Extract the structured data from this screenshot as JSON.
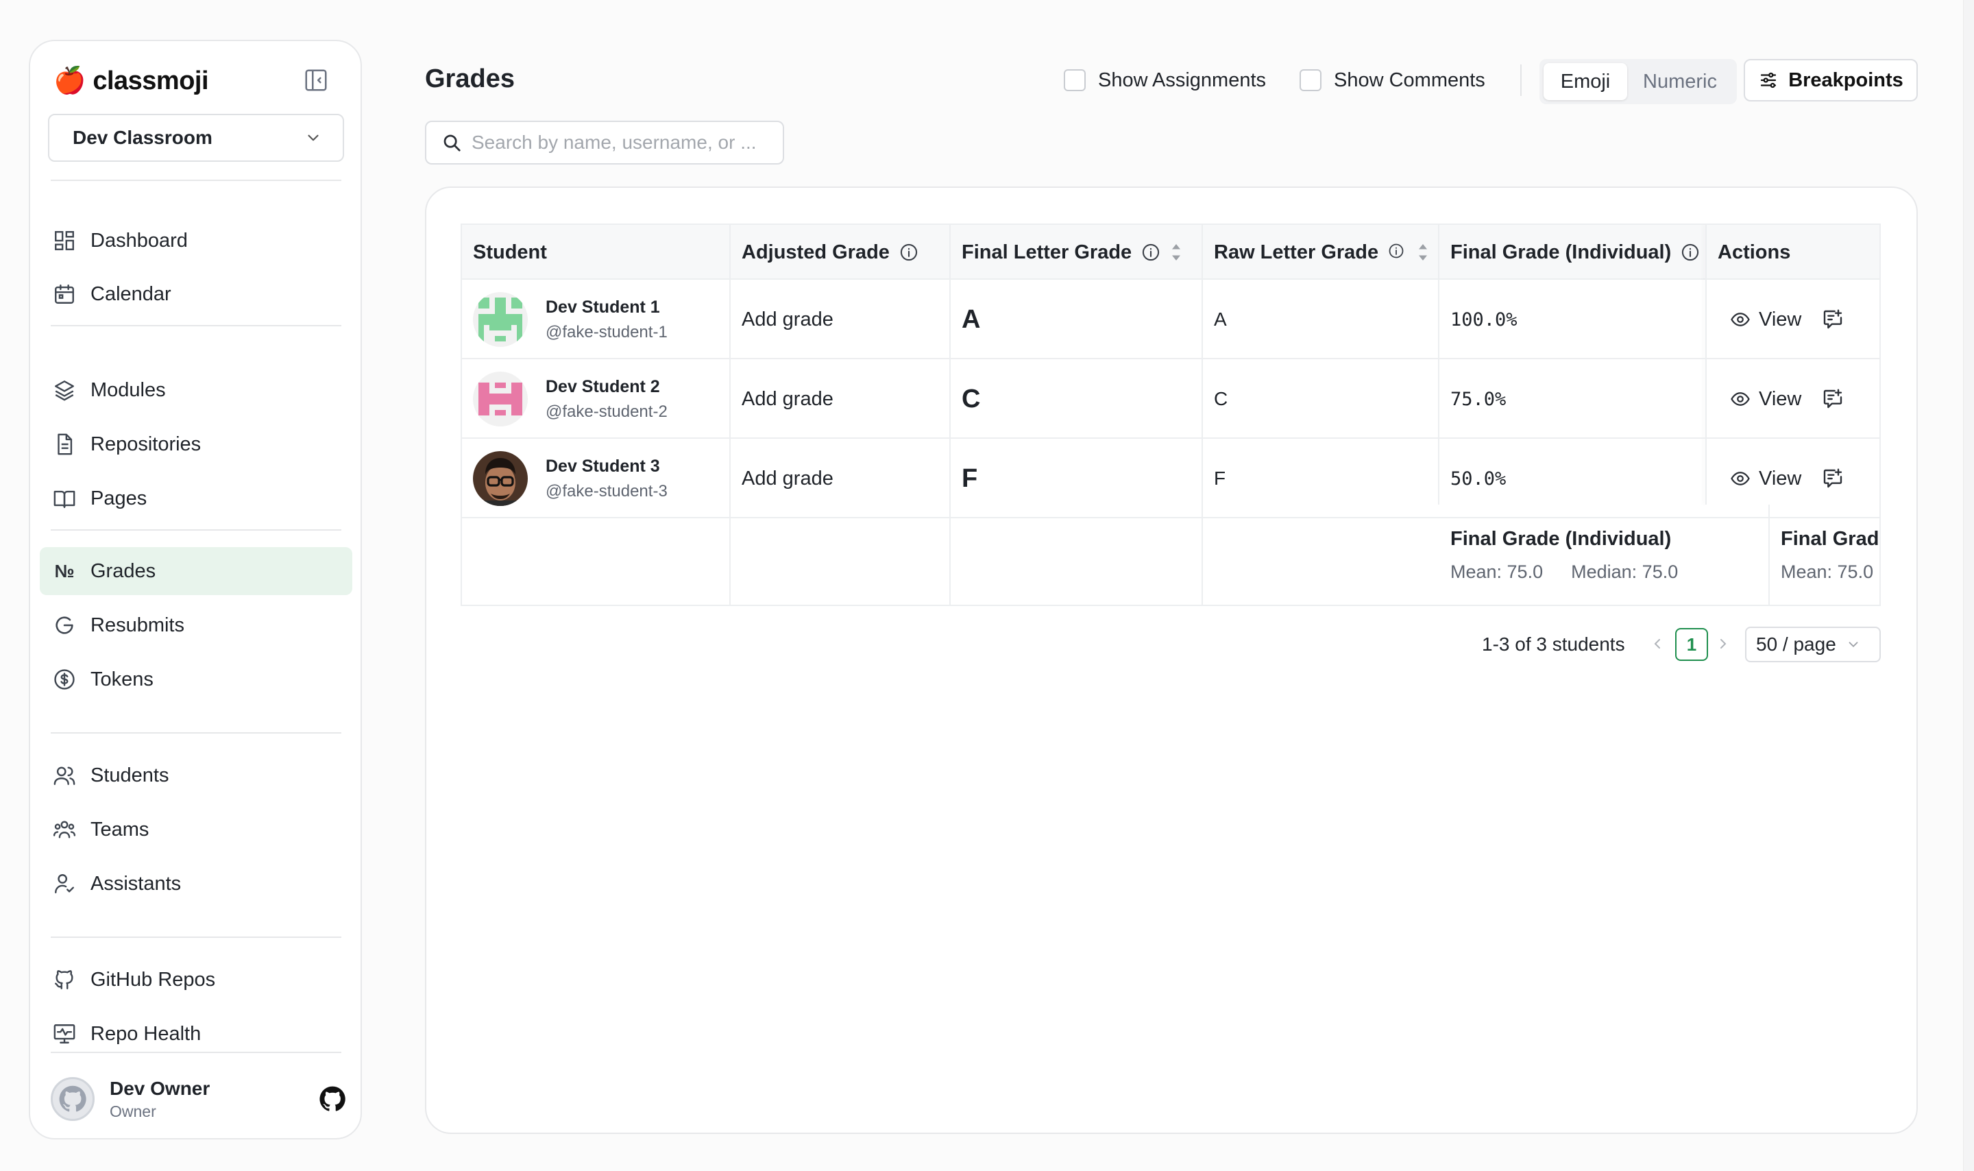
{
  "app": {
    "name": "classmoji",
    "logo_emoji": "🍎"
  },
  "sidebar": {
    "classroom_select": "Dev Classroom",
    "groups": [
      [
        {
          "label": "Dashboard",
          "icon": "dashboard-icon"
        },
        {
          "label": "Calendar",
          "icon": "calendar-icon"
        }
      ],
      [
        {
          "label": "Modules",
          "icon": "layers-icon"
        },
        {
          "label": "Repositories",
          "icon": "file-icon"
        },
        {
          "label": "Pages",
          "icon": "book-icon"
        }
      ],
      [
        {
          "label": "Grades",
          "icon": "numero-icon",
          "active": true
        },
        {
          "label": "Resubmits",
          "icon": "resubmit-icon"
        },
        {
          "label": "Tokens",
          "icon": "dollar-icon"
        }
      ],
      [
        {
          "label": "Students",
          "icon": "users-icon"
        },
        {
          "label": "Teams",
          "icon": "team-icon"
        },
        {
          "label": "Assistants",
          "icon": "user-check-icon"
        }
      ],
      [
        {
          "label": "GitHub Repos",
          "icon": "github-icon"
        },
        {
          "label": "Repo Health",
          "icon": "monitor-icon"
        }
      ]
    ],
    "numero_glyph": "№",
    "user": {
      "name": "Dev Owner",
      "role": "Owner"
    }
  },
  "header": {
    "title": "Grades",
    "show_assignments": "Show Assignments",
    "show_comments": "Show Comments",
    "toggle": {
      "emoji": "Emoji",
      "numeric": "Numeric",
      "selected": "Emoji"
    },
    "breakpoints": "Breakpoints"
  },
  "search": {
    "placeholder": "Search by name, username, or ..."
  },
  "table": {
    "columns": [
      "Student",
      "Adjusted Grade",
      "Final Letter Grade",
      "Raw Letter Grade",
      "Final Grade (Individual)",
      "Actions"
    ],
    "rows": [
      {
        "name": "Dev Student 1",
        "username": "@fake-student-1",
        "adjusted": "Add grade",
        "final_letter": "A",
        "raw_letter": "A",
        "final_pct": "100.0%",
        "action": "View",
        "avatar": "identicon-green"
      },
      {
        "name": "Dev Student 2",
        "username": "@fake-student-2",
        "adjusted": "Add grade",
        "final_letter": "C",
        "raw_letter": "C",
        "final_pct": "75.0%",
        "action": "View",
        "avatar": "identicon-pink"
      },
      {
        "name": "Dev Student 3",
        "username": "@fake-student-3",
        "adjusted": "Add grade",
        "final_letter": "F",
        "raw_letter": "F",
        "final_pct": "50.0%",
        "action": "View",
        "avatar": "photo-glasses"
      }
    ],
    "summary": [
      {
        "title": "Final Grade (Individual)",
        "mean": "Mean: 75.0",
        "median": "Median: 75.0"
      },
      {
        "title": "Final Grade",
        "mean": "Mean: 75.0"
      }
    ]
  },
  "pagination": {
    "total": "1-3 of 3 students",
    "current_page": "1",
    "page_size": "50 / page"
  },
  "colors": {
    "accent_green": "#1f8f4e",
    "active_nav_bg": "#e8f4ec"
  }
}
